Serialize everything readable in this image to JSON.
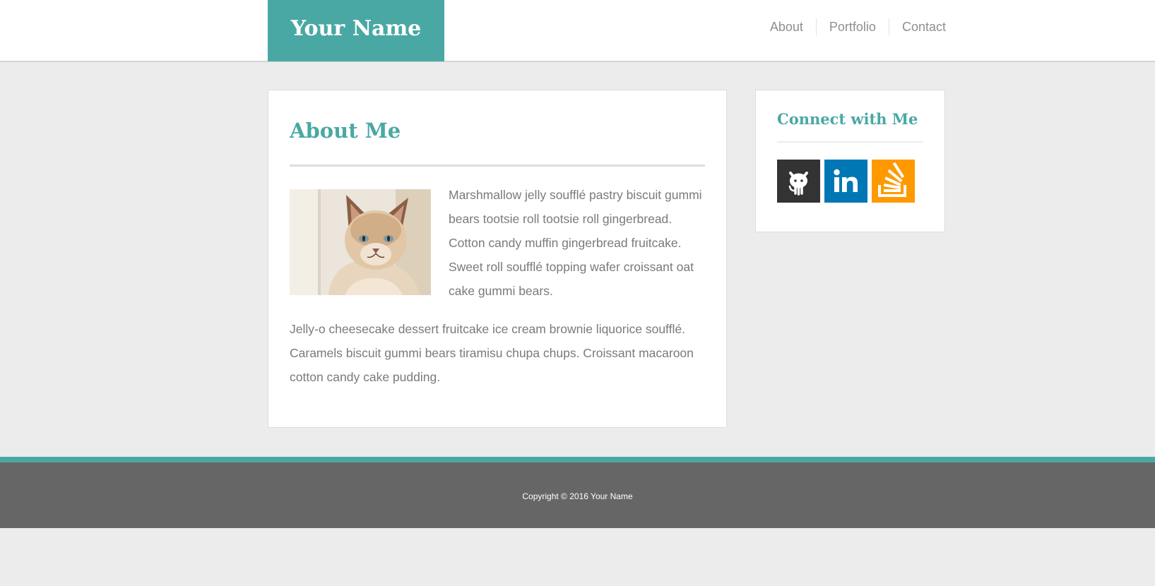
{
  "header": {
    "brand": "Your Name",
    "nav": [
      {
        "label": "About"
      },
      {
        "label": "Portfolio"
      },
      {
        "label": "Contact"
      }
    ]
  },
  "main": {
    "title": "About Me",
    "image_icon": "cat-photo",
    "paragraphs": [
      "Marshmallow jelly soufflé pastry biscuit gummi bears tootsie roll tootsie roll gingerbread. Cotton candy muffin gingerbread fruitcake. Sweet roll soufflé topping wafer croissant oat cake gummi bears.",
      "Jelly-o cheesecake dessert fruitcake ice cream brownie liquorice soufflé. Caramels biscuit gummi bears tiramisu chupa chups. Croissant macaroon cotton candy cake pudding."
    ]
  },
  "sidebar": {
    "title": "Connect with Me",
    "social": [
      {
        "icon": "github-icon",
        "color": "#333333"
      },
      {
        "icon": "linkedin-icon",
        "color": "#0077b5"
      },
      {
        "icon": "stackoverflow-icon",
        "color": "#fe9a00"
      }
    ]
  },
  "footer": {
    "copyright": "Copyright © 2016 Your Name"
  },
  "colors": {
    "accent": "#4aa8a4",
    "footer": "#666666",
    "background": "#ececec"
  }
}
